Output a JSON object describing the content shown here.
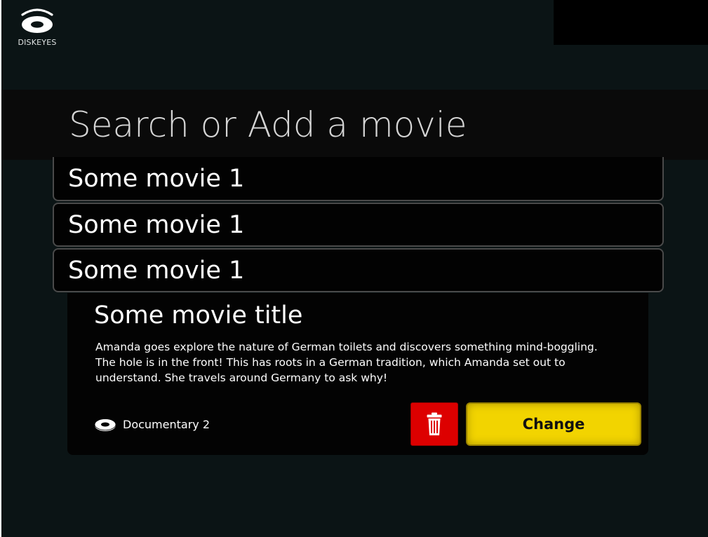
{
  "app": {
    "logo_text": "DISKEYES"
  },
  "search": {
    "placeholder": "Search or Add a movie",
    "value": ""
  },
  "results": [
    {
      "title": "Some movie 1"
    },
    {
      "title": "Some movie 1"
    },
    {
      "title": "Some movie 1"
    }
  ],
  "detail": {
    "title": "Some movie title",
    "description": "Amanda goes explore the nature of German toilets and discovers something mind-boggling. The hole is in the front! This has roots in a German tradition, which Amanda set out to understand.  She travels around Germany to ask why!",
    "genre": "Documentary 2",
    "genre_icon": "disc-icon",
    "delete_icon": "trash-icon",
    "change_label": "Change"
  },
  "colors": {
    "background": "#0b1415",
    "search_bar": "#0a0a0a",
    "delete": "#dd0000",
    "change": "#f2d400"
  }
}
